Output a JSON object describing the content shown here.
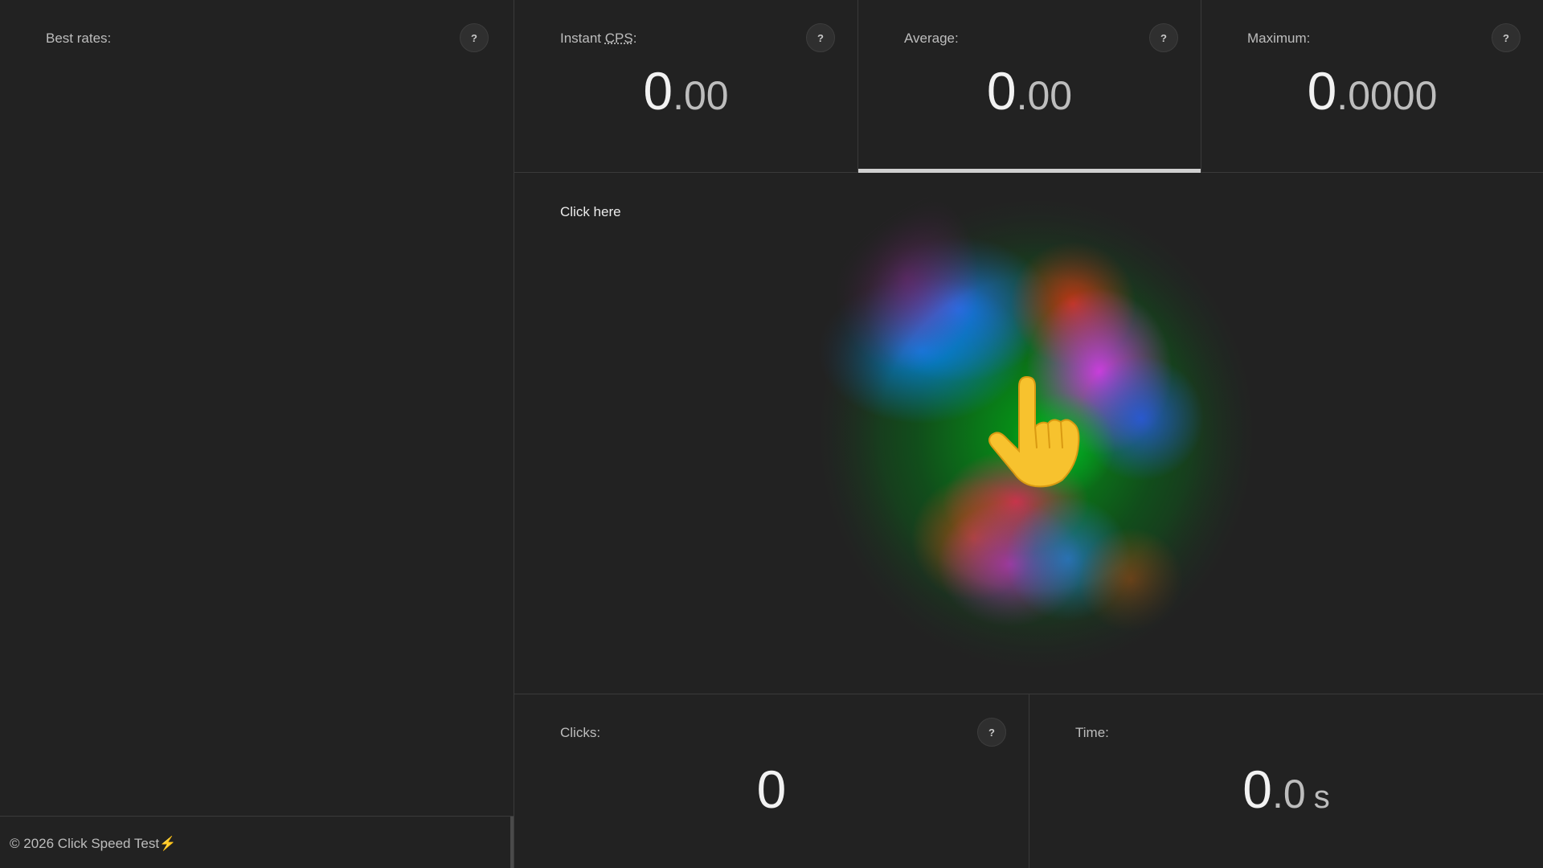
{
  "sidebar": {
    "title": "Best rates:",
    "help": "?",
    "footer": "© 2026 Click Speed Test⚡"
  },
  "stats": {
    "instant": {
      "label_pre": "Instant ",
      "label_abbr": "CPS",
      "label_post": ":",
      "int": "0",
      "dot": ".",
      "frac": "00",
      "help": "?"
    },
    "average": {
      "label": "Average:",
      "int": "0",
      "dot": ".",
      "frac": "00",
      "help": "?"
    },
    "maximum": {
      "label": "Maximum:",
      "int": "0",
      "dot": ".",
      "frac": "0000",
      "help": "?"
    }
  },
  "click_area": {
    "label": "Click here",
    "icon": "pointing-hand-icon"
  },
  "bottom": {
    "clicks": {
      "label": "Clicks:",
      "value": "0",
      "help": "?"
    },
    "time": {
      "label": "Time:",
      "int": "0",
      "dot": ".",
      "frac": "0",
      "unit": "s"
    }
  },
  "colors": {
    "background": "#222222",
    "border": "#3a3a3a",
    "text": "#bdbdbd",
    "value": "#f2f2f2",
    "active_tab": "#d0d0d0"
  }
}
